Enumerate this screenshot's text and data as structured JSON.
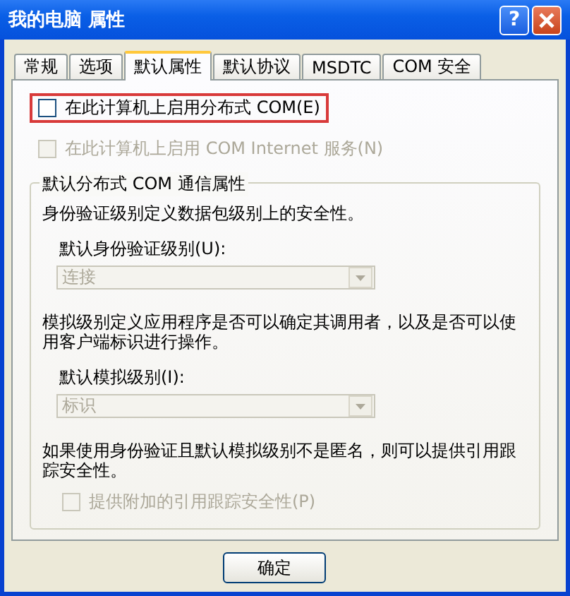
{
  "window": {
    "title": "我的电脑 属性",
    "help_button": "?"
  },
  "tabs": [
    {
      "label": "常规",
      "selected": false
    },
    {
      "label": "选项",
      "selected": false
    },
    {
      "label": "默认属性",
      "selected": true
    },
    {
      "label": "默认协议",
      "selected": false
    },
    {
      "label": "MSDTC",
      "selected": false
    },
    {
      "label": "COM 安全",
      "selected": false
    }
  ],
  "checkboxes": [
    {
      "label": "在此计算机上启用分布式 COM(E)",
      "checked": false,
      "disabled": false,
      "highlighted": true
    },
    {
      "label": "在此计算机上启用 COM Internet 服务(N)",
      "checked": false,
      "disabled": true,
      "highlighted": false
    }
  ],
  "group": {
    "title": "默认分布式 COM 通信属性",
    "sections": [
      {
        "description": "身份验证级别定义数据包级别上的安全性。",
        "dropdown": {
          "label": "默认身份验证级别(U):",
          "value": "连接",
          "disabled": true
        }
      },
      {
        "description": "模拟级别定义应用程序是否可以确定其调用者，以及是否可以使用客户端标识进行操作。",
        "dropdown": {
          "label": "默认模拟级别(I):",
          "value": "标识",
          "disabled": true
        }
      }
    ],
    "footer_text": "如果使用身份验证且默认模拟级别不是匿名，则可以提供引用跟踪安全性。",
    "footer_checkbox": {
      "label": "提供附加的引用跟踪安全性(P)",
      "checked": false,
      "disabled": true
    }
  },
  "buttons": [
    "确定"
  ]
}
